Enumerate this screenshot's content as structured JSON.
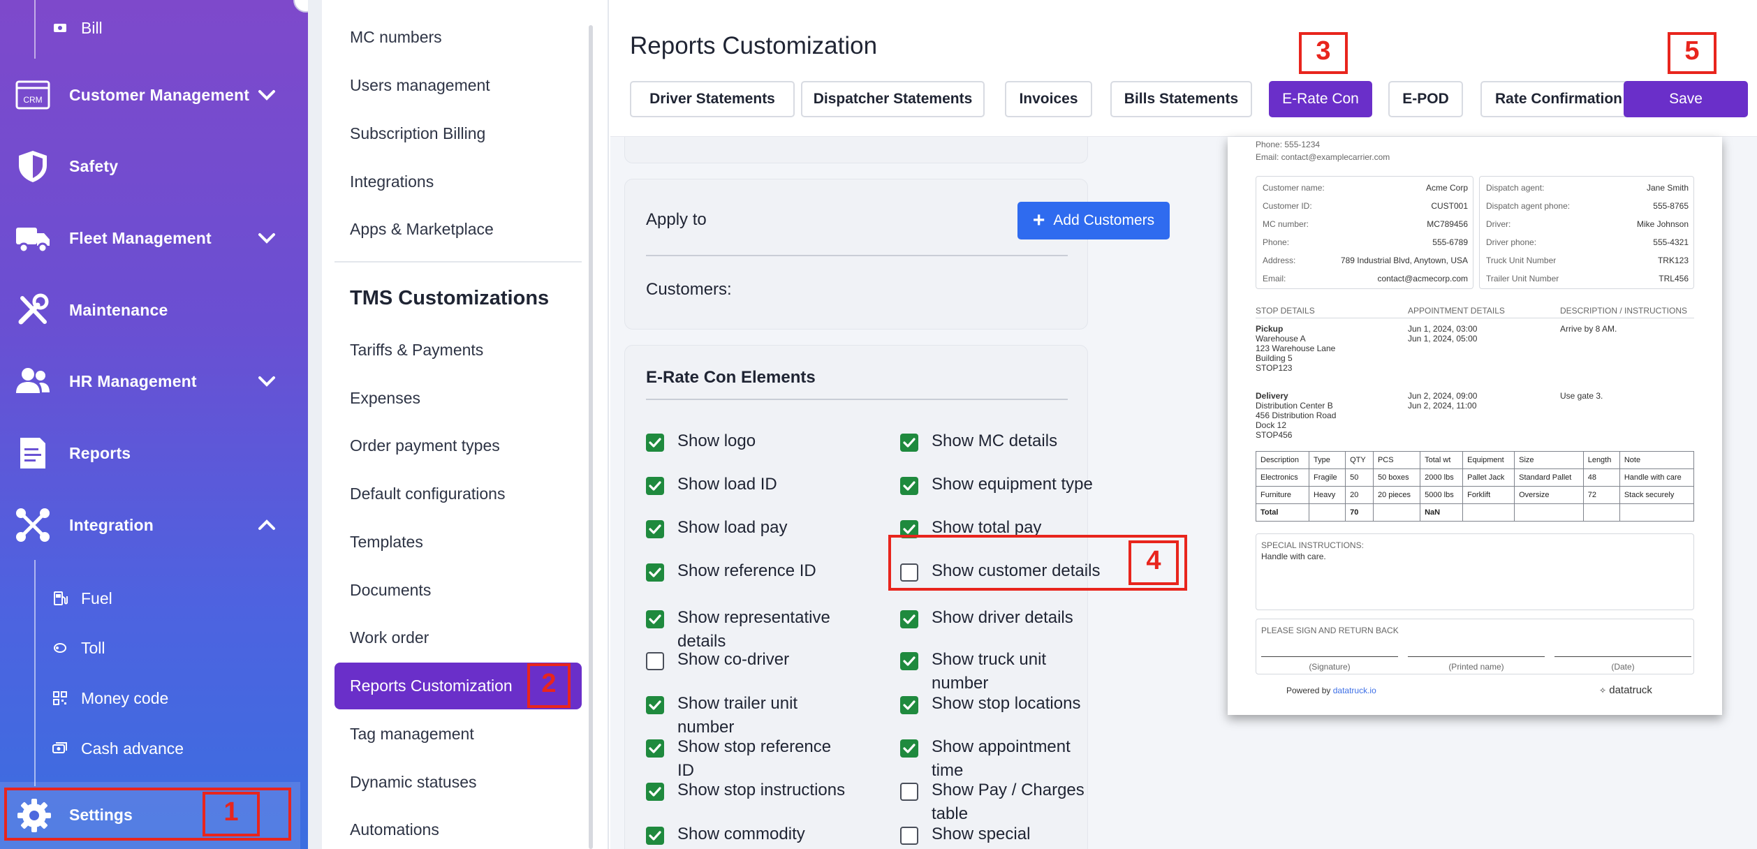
{
  "sidebar": {
    "bill_label": "Bill",
    "items": [
      {
        "label": "Customer Management",
        "icon": "crm-icon"
      },
      {
        "label": "Safety",
        "icon": "shield-icon"
      },
      {
        "label": "Fleet Management",
        "icon": "truck-icon"
      },
      {
        "label": "Maintenance",
        "icon": "wrench-icon"
      },
      {
        "label": "HR Management",
        "icon": "people-icon"
      },
      {
        "label": "Reports",
        "icon": "report-icon"
      },
      {
        "label": "Integration",
        "icon": "integration-icon"
      }
    ],
    "integration_sub": [
      {
        "label": "Fuel",
        "icon": "fuel-icon"
      },
      {
        "label": "Toll",
        "icon": "toll-icon"
      },
      {
        "label": "Money code",
        "icon": "money-code-icon"
      },
      {
        "label": "Cash advance",
        "icon": "cash-advance-icon"
      }
    ],
    "settings_label": "Settings"
  },
  "annotations": [
    "1",
    "2",
    "3",
    "4",
    "5"
  ],
  "menu": {
    "items_top": [
      "MC numbers",
      "Users management",
      "Subscription Billing",
      "Integrations",
      "Apps & Marketplace"
    ],
    "section_title": "TMS Customizations",
    "items": [
      "Tariffs & Payments",
      "Expenses",
      "Order payment types",
      "Default configurations",
      "Templates",
      "Documents",
      "Work order",
      "Reports Customization",
      "Tag management",
      "Dynamic statuses",
      "Automations"
    ],
    "active_index": 7
  },
  "page": {
    "title": "Reports Customization",
    "tabs": [
      "Driver Statements",
      "Dispatcher Statements",
      "Invoices",
      "Bills Statements",
      "E-Rate Con",
      "E-POD",
      "Rate Confirmation"
    ],
    "selected_tab": "E-Rate Con",
    "save_label": "Save"
  },
  "apply": {
    "title": "Apply to",
    "add_button": "Add Customers",
    "customers_label": "Customers:"
  },
  "elements": {
    "title": "E-Rate Con Elements",
    "left": [
      {
        "label": "Show logo",
        "checked": true
      },
      {
        "label": "Show load ID",
        "checked": true
      },
      {
        "label": "Show load pay",
        "checked": true
      },
      {
        "label": "Show reference ID",
        "checked": true
      },
      {
        "label": "Show representative details",
        "checked": true
      },
      {
        "label": "Show co-driver",
        "checked": false
      },
      {
        "label": "Show trailer unit number",
        "checked": true
      },
      {
        "label": "Show stop reference ID",
        "checked": true
      },
      {
        "label": "Show stop instructions",
        "checked": true
      },
      {
        "label": "Show commodity details",
        "checked": true
      }
    ],
    "right": [
      {
        "label": "Show MC details",
        "checked": true
      },
      {
        "label": "Show equipment type",
        "checked": true
      },
      {
        "label": "Show total pay",
        "checked": true
      },
      {
        "label": "Show customer details",
        "checked": false
      },
      {
        "label": "Show driver details",
        "checked": true
      },
      {
        "label": "Show truck unit number",
        "checked": true
      },
      {
        "label": "Show stop locations",
        "checked": true
      },
      {
        "label": "Show appointment time",
        "checked": true
      },
      {
        "label": "Show Pay / Charges table",
        "checked": false
      },
      {
        "label": "Show special instructions",
        "checked": false
      }
    ]
  },
  "preview": {
    "phone": "Phone: 555-1234",
    "email": "Email: contact@examplecarrier.com",
    "customer": [
      [
        "Customer name:",
        "Acme Corp"
      ],
      [
        "Customer ID:",
        "CUST001"
      ],
      [
        "MC number:",
        "MC789456"
      ],
      [
        "Phone:",
        "555-6789"
      ],
      [
        "Address:",
        "789 Industrial Blvd, Anytown, USA"
      ],
      [
        "Email:",
        "contact@acmecorp.com"
      ]
    ],
    "dispatch": [
      [
        "Dispatch agent:",
        "Jane Smith"
      ],
      [
        "Dispatch agent phone:",
        "555-8765"
      ],
      [
        "Driver:",
        "Mike Johnson"
      ],
      [
        "Driver phone:",
        "555-4321"
      ],
      [
        "Truck Unit Number",
        "TRK123"
      ],
      [
        "Trailer Unit Number",
        "TRL456"
      ]
    ],
    "stop_headers": [
      "STOP DETAILS",
      "APPOINTMENT DETAILS",
      "DESCRIPTION / INSTRUCTIONS"
    ],
    "stops": [
      {
        "type": "Pickup",
        "lines": [
          "Warehouse A",
          "123 Warehouse Lane",
          "Building 5",
          "STOP123"
        ],
        "appt": [
          "Jun 1, 2024, 03:00",
          "Jun 1, 2024, 05:00"
        ],
        "note": "Arrive by 8 AM."
      },
      {
        "type": "Delivery",
        "lines": [
          "Distribution Center B",
          "456 Distribution Road",
          "Dock 12",
          "STOP456"
        ],
        "appt": [
          "Jun 2, 2024, 09:00",
          "Jun 2, 2024, 11:00"
        ],
        "note": "Use gate 3."
      }
    ],
    "table_headers": [
      "Description",
      "Type",
      "QTY",
      "PCS",
      "Total wt",
      "Equipment",
      "Size",
      "Length",
      "Note"
    ],
    "table_rows": [
      [
        "Electronics",
        "Fragile",
        "50",
        "50 boxes",
        "2000 lbs",
        "Pallet Jack",
        "Standard Pallet",
        "48",
        "Handle with care"
      ],
      [
        "Furniture",
        "Heavy",
        "20",
        "20 pieces",
        "5000 lbs",
        "Forklift",
        "Oversize",
        "72",
        "Stack securely"
      ],
      [
        "Total",
        "",
        "70",
        "",
        "NaN",
        "",
        "",
        "",
        ""
      ]
    ],
    "special_title": "SPECIAL INSTRUCTIONS:",
    "special_text": "Handle with care.",
    "sign_title": "PLEASE SIGN AND RETURN BACK",
    "sign_labels": [
      "(Signature)",
      "(Printed name)",
      "(Date)"
    ],
    "powered_prefix": "Powered by",
    "powered_link": "datatruck.io",
    "brand": "datatruck"
  }
}
